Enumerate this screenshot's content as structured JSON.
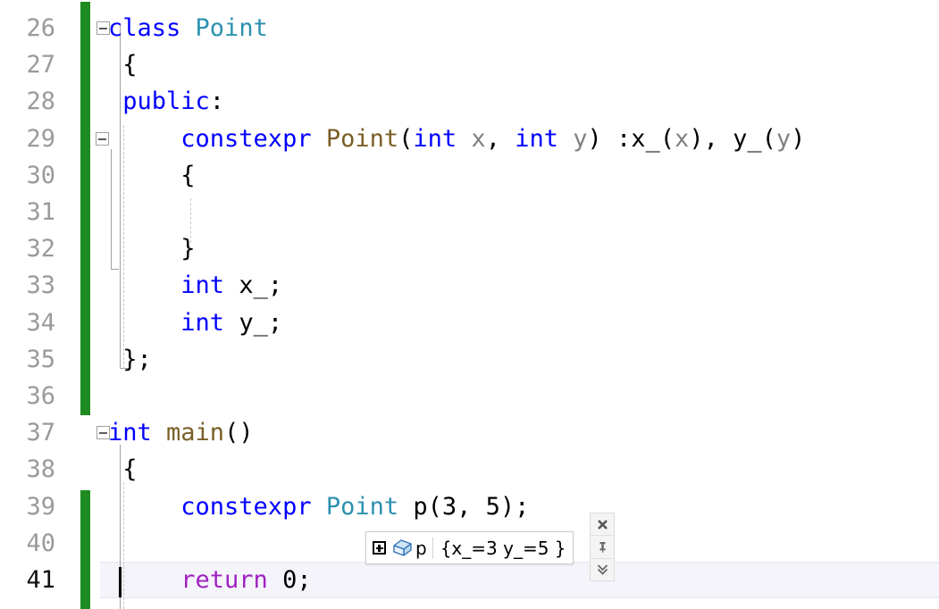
{
  "editor": {
    "app": "visual-studio-code-editor",
    "language": "cpp",
    "colors": {
      "keyword": "#0000ff",
      "type": "#2b91af",
      "function": "#795e26",
      "parameter": "#808080",
      "control": "#a020c0",
      "plain": "#000000",
      "line_number": "#9a9a9a",
      "line_number_current": "#111111",
      "change_bar_saved": "#1d8b22",
      "current_line_bg": "#f4f4fa",
      "background": "#ffffff"
    },
    "lines": [
      {
        "number": "26",
        "fold": "minus",
        "tokens": [
          {
            "text": "class ",
            "kind": "keyword"
          },
          {
            "text": "Point",
            "kind": "type"
          }
        ]
      },
      {
        "number": "27",
        "tokens": [
          {
            "text": " {",
            "kind": "plain"
          }
        ]
      },
      {
        "number": "28",
        "tokens": [
          {
            "text": " public",
            "kind": "keyword"
          },
          {
            "text": ":",
            "kind": "plain"
          }
        ]
      },
      {
        "number": "29",
        "fold": "minus",
        "tokens": [
          {
            "text": "     constexpr ",
            "kind": "keyword"
          },
          {
            "text": "Point",
            "kind": "function"
          },
          {
            "text": "(",
            "kind": "plain"
          },
          {
            "text": "int ",
            "kind": "keyword"
          },
          {
            "text": "x",
            "kind": "parameter"
          },
          {
            "text": ", ",
            "kind": "plain"
          },
          {
            "text": "int ",
            "kind": "keyword"
          },
          {
            "text": "y",
            "kind": "parameter"
          },
          {
            "text": ") :x_(",
            "kind": "plain"
          },
          {
            "text": "x",
            "kind": "parameter"
          },
          {
            "text": "), y_(",
            "kind": "plain"
          },
          {
            "text": "y",
            "kind": "parameter"
          },
          {
            "text": ")",
            "kind": "plain"
          }
        ]
      },
      {
        "number": "30",
        "tokens": [
          {
            "text": "     {",
            "kind": "plain"
          }
        ]
      },
      {
        "number": "31",
        "tokens": []
      },
      {
        "number": "32",
        "tokens": [
          {
            "text": "     }",
            "kind": "plain"
          }
        ]
      },
      {
        "number": "33",
        "tokens": [
          {
            "text": "     int ",
            "kind": "keyword"
          },
          {
            "text": "x_;",
            "kind": "plain"
          }
        ]
      },
      {
        "number": "34",
        "tokens": [
          {
            "text": "     int ",
            "kind": "keyword"
          },
          {
            "text": "y_;",
            "kind": "plain"
          }
        ]
      },
      {
        "number": "35",
        "tokens": [
          {
            "text": " };",
            "kind": "plain"
          }
        ]
      },
      {
        "number": "36",
        "tokens": []
      },
      {
        "number": "37",
        "fold": "minus",
        "tokens": [
          {
            "text": "int ",
            "kind": "keyword"
          },
          {
            "text": "main",
            "kind": "function"
          },
          {
            "text": "()",
            "kind": "plain"
          }
        ]
      },
      {
        "number": "38",
        "tokens": [
          {
            "text": " {",
            "kind": "plain"
          }
        ]
      },
      {
        "number": "39",
        "tokens": [
          {
            "text": "     constexpr ",
            "kind": "keyword"
          },
          {
            "text": "Point",
            "kind": "type"
          },
          {
            "text": " p(3, 5);",
            "kind": "plain"
          }
        ]
      },
      {
        "number": "40",
        "tokens": []
      },
      {
        "number": "41",
        "current": true,
        "tokens": [
          {
            "text": "     return ",
            "kind": "control"
          },
          {
            "text": "0;",
            "kind": "plain"
          }
        ]
      }
    ]
  },
  "datatip": {
    "expander_state": "collapsed",
    "expander_glyph": "+",
    "icon": "object-box-icon",
    "name": "p",
    "value": "{x_=3 y_=5 }",
    "toolbar": [
      {
        "name": "close-button",
        "glyph": "✕",
        "title": "Close"
      },
      {
        "name": "pin-button",
        "glyph": "pin",
        "title": "Pin to source"
      },
      {
        "name": "expand-button",
        "glyph": "»",
        "title": "Expand"
      }
    ]
  }
}
